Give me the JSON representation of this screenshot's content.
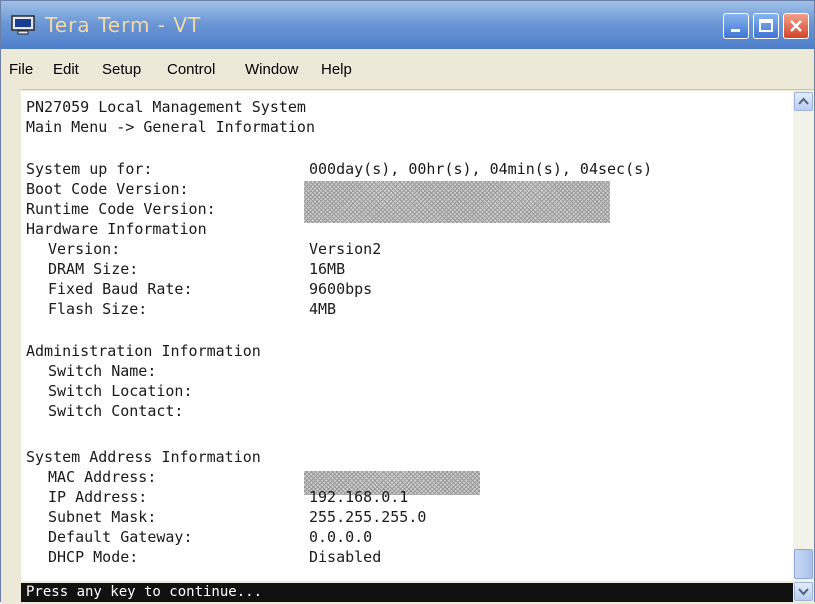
{
  "window": {
    "title": "Tera Term - VT",
    "icon": "terminal-icon",
    "controls": [
      "minimize-icon",
      "maximize-icon",
      "close-icon"
    ]
  },
  "menu": [
    {
      "label": "File"
    },
    {
      "label": "Edit"
    },
    {
      "label": "Setup"
    },
    {
      "label": "Control"
    },
    {
      "label": "Window"
    },
    {
      "label": "Help"
    }
  ],
  "terminal": {
    "header": {
      "system_name": "PN27059 Local Management System",
      "breadcrumb": "Main Menu -> General Information"
    },
    "system": {
      "uptime_label": "System up for:",
      "uptime_value": "000day(s), 00hr(s), 04min(s), 04sec(s)",
      "boot_label": "Boot Code Version:",
      "runtime_label": "Runtime Code Version:"
    },
    "hardware": {
      "heading": "Hardware Information",
      "version_label": "Version:",
      "version_value": "Version2",
      "dram_label": "DRAM Size:",
      "dram_value": "16MB",
      "baud_label": "Fixed Baud Rate:",
      "baud_value": "9600bps",
      "flash_label": "Flash Size:",
      "flash_value": "4MB"
    },
    "admin": {
      "heading": "Administration Information",
      "name_label": "Switch Name:",
      "location_label": "Switch Location:",
      "contact_label": "Switch Contact:"
    },
    "address": {
      "heading": "System Address Information",
      "mac_label": "MAC Address:",
      "ip_label": "IP Address:",
      "ip_value": "192.168.0.1",
      "subnet_label": "Subnet Mask:",
      "subnet_value": "255.255.255.0",
      "gateway_label": "Default Gateway:",
      "gateway_value": "0.0.0.0",
      "dhcp_label": "DHCP Mode:",
      "dhcp_value": "Disabled"
    }
  },
  "status_bar": {
    "prompt": "Press any key to continue..."
  }
}
